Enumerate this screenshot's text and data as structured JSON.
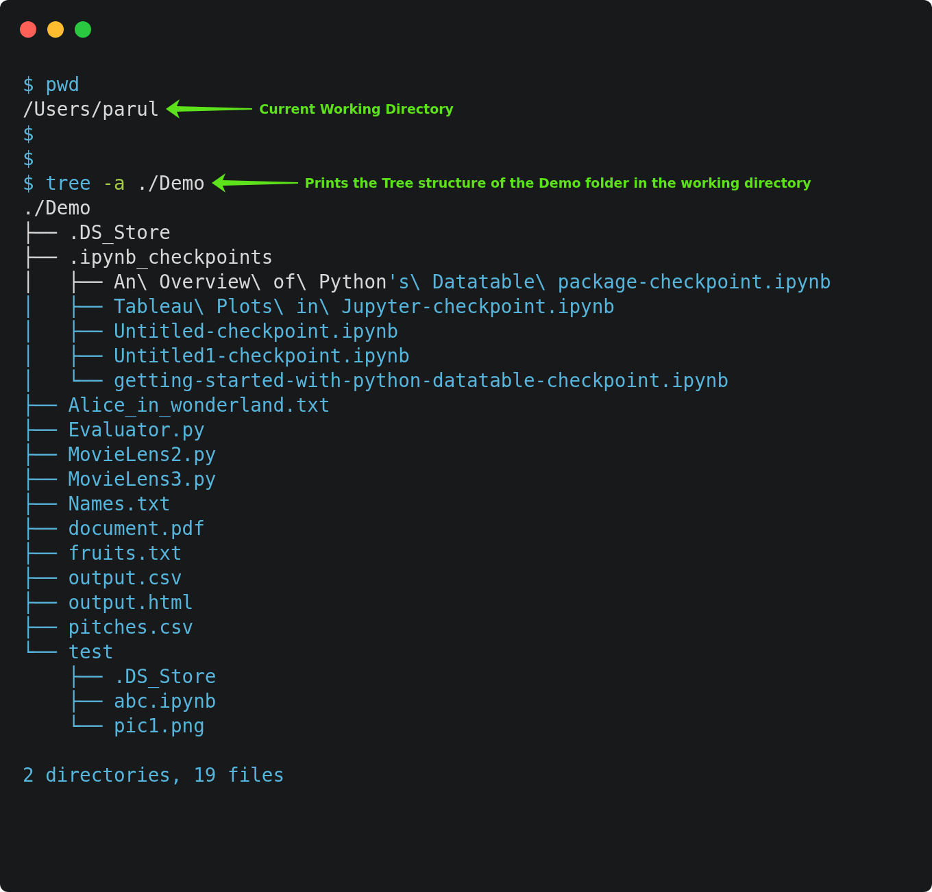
{
  "window": {
    "controls": [
      {
        "color": "#fe5f57"
      },
      {
        "color": "#febc2e"
      },
      {
        "color": "#29c840"
      }
    ]
  },
  "lines": [
    {
      "segments": [
        {
          "text": "$ pwd",
          "kind": "command",
          "highlighted": true
        }
      ]
    },
    {
      "segments": [
        {
          "text": "/Users/parul",
          "kind": "output",
          "highlighted": false
        }
      ],
      "annotation": "Current Working Directory"
    },
    {
      "segments": [
        {
          "text": "$",
          "kind": "prompt",
          "highlighted": true
        }
      ]
    },
    {
      "segments": [
        {
          "text": "$",
          "kind": "prompt",
          "highlighted": true
        }
      ]
    },
    {
      "segments": [
        {
          "text": "$ tree",
          "kind": "command",
          "highlighted": true
        },
        {
          "text": " -a",
          "kind": "flag"
        },
        {
          "text": " ./Demo",
          "kind": "argument",
          "highlighted": false
        }
      ],
      "annotation": "Prints the Tree structure of the Demo folder in the working directory"
    },
    {
      "segments": [
        {
          "text": "./Demo",
          "kind": "output",
          "highlighted": false
        }
      ]
    },
    {
      "segments": [
        {
          "text": "├── ",
          "kind": "branch",
          "highlighted": false
        },
        {
          "text": ".DS_Store",
          "kind": "output",
          "highlighted": false
        }
      ]
    },
    {
      "segments": [
        {
          "text": "├── ",
          "kind": "branch",
          "highlighted": false
        },
        {
          "text": ".ipynb_checkpoints",
          "kind": "output",
          "highlighted": false
        }
      ]
    },
    {
      "segments": [
        {
          "text": "│   ├── ",
          "kind": "branch",
          "highlighted": false
        },
        {
          "text": "An\\ Overview\\ of\\ Python",
          "kind": "output",
          "highlighted": false
        },
        {
          "text": "'s\\ Datatable\\ package-checkpoint.ipynb",
          "kind": "output",
          "highlighted": true
        }
      ]
    },
    {
      "segments": [
        {
          "text": "│   ├── ",
          "kind": "branch",
          "highlighted": true
        },
        {
          "text": "Tableau\\ Plots\\ in\\ Jupyter-checkpoint.ipynb",
          "kind": "output",
          "highlighted": true
        }
      ]
    },
    {
      "segments": [
        {
          "text": "│   ├── ",
          "kind": "branch",
          "highlighted": true
        },
        {
          "text": "Untitled-checkpoint.ipynb",
          "kind": "output",
          "highlighted": true
        }
      ]
    },
    {
      "segments": [
        {
          "text": "│   ├── ",
          "kind": "branch",
          "highlighted": true
        },
        {
          "text": "Untitled1-checkpoint.ipynb",
          "kind": "output",
          "highlighted": true
        }
      ]
    },
    {
      "segments": [
        {
          "text": "│   └── ",
          "kind": "branch",
          "highlighted": true
        },
        {
          "text": "getting-started-with-python-datatable-checkpoint.ipynb",
          "kind": "output",
          "highlighted": true
        }
      ]
    },
    {
      "segments": [
        {
          "text": "├── ",
          "kind": "branch",
          "highlighted": true
        },
        {
          "text": "Alice_in_wonderland.txt",
          "kind": "output",
          "highlighted": true
        }
      ]
    },
    {
      "segments": [
        {
          "text": "├── ",
          "kind": "branch",
          "highlighted": true
        },
        {
          "text": "Evaluator.py",
          "kind": "output",
          "highlighted": true
        }
      ]
    },
    {
      "segments": [
        {
          "text": "├── ",
          "kind": "branch",
          "highlighted": true
        },
        {
          "text": "MovieLens2.py",
          "kind": "output",
          "highlighted": true
        }
      ]
    },
    {
      "segments": [
        {
          "text": "├── ",
          "kind": "branch",
          "highlighted": true
        },
        {
          "text": "MovieLens3.py",
          "kind": "output",
          "highlighted": true
        }
      ]
    },
    {
      "segments": [
        {
          "text": "├── ",
          "kind": "branch",
          "highlighted": true
        },
        {
          "text": "Names.txt",
          "kind": "output",
          "highlighted": true
        }
      ]
    },
    {
      "segments": [
        {
          "text": "├── ",
          "kind": "branch",
          "highlighted": true
        },
        {
          "text": "document.pdf",
          "kind": "output",
          "highlighted": true
        }
      ]
    },
    {
      "segments": [
        {
          "text": "├── ",
          "kind": "branch",
          "highlighted": true
        },
        {
          "text": "fruits.txt",
          "kind": "output",
          "highlighted": true
        }
      ]
    },
    {
      "segments": [
        {
          "text": "├── ",
          "kind": "branch",
          "highlighted": true
        },
        {
          "text": "output.csv",
          "kind": "output",
          "highlighted": true
        }
      ]
    },
    {
      "segments": [
        {
          "text": "├── ",
          "kind": "branch",
          "highlighted": true
        },
        {
          "text": "output.html",
          "kind": "output",
          "highlighted": true
        }
      ]
    },
    {
      "segments": [
        {
          "text": "├── ",
          "kind": "branch",
          "highlighted": true
        },
        {
          "text": "pitches.csv",
          "kind": "output",
          "highlighted": true
        }
      ]
    },
    {
      "segments": [
        {
          "text": "└── ",
          "kind": "branch",
          "highlighted": true
        },
        {
          "text": "test",
          "kind": "output",
          "highlighted": true
        }
      ]
    },
    {
      "segments": [
        {
          "text": "    ├── ",
          "kind": "branch",
          "highlighted": true
        },
        {
          "text": ".DS_Store",
          "kind": "output",
          "highlighted": true
        }
      ]
    },
    {
      "segments": [
        {
          "text": "    ├── ",
          "kind": "branch",
          "highlighted": true
        },
        {
          "text": "abc.ipynb",
          "kind": "output",
          "highlighted": true
        }
      ]
    },
    {
      "segments": [
        {
          "text": "    └── ",
          "kind": "branch",
          "highlighted": true
        },
        {
          "text": "pic1.png",
          "kind": "output",
          "highlighted": true
        }
      ]
    }
  ],
  "summary": "2 directories, 19 files"
}
